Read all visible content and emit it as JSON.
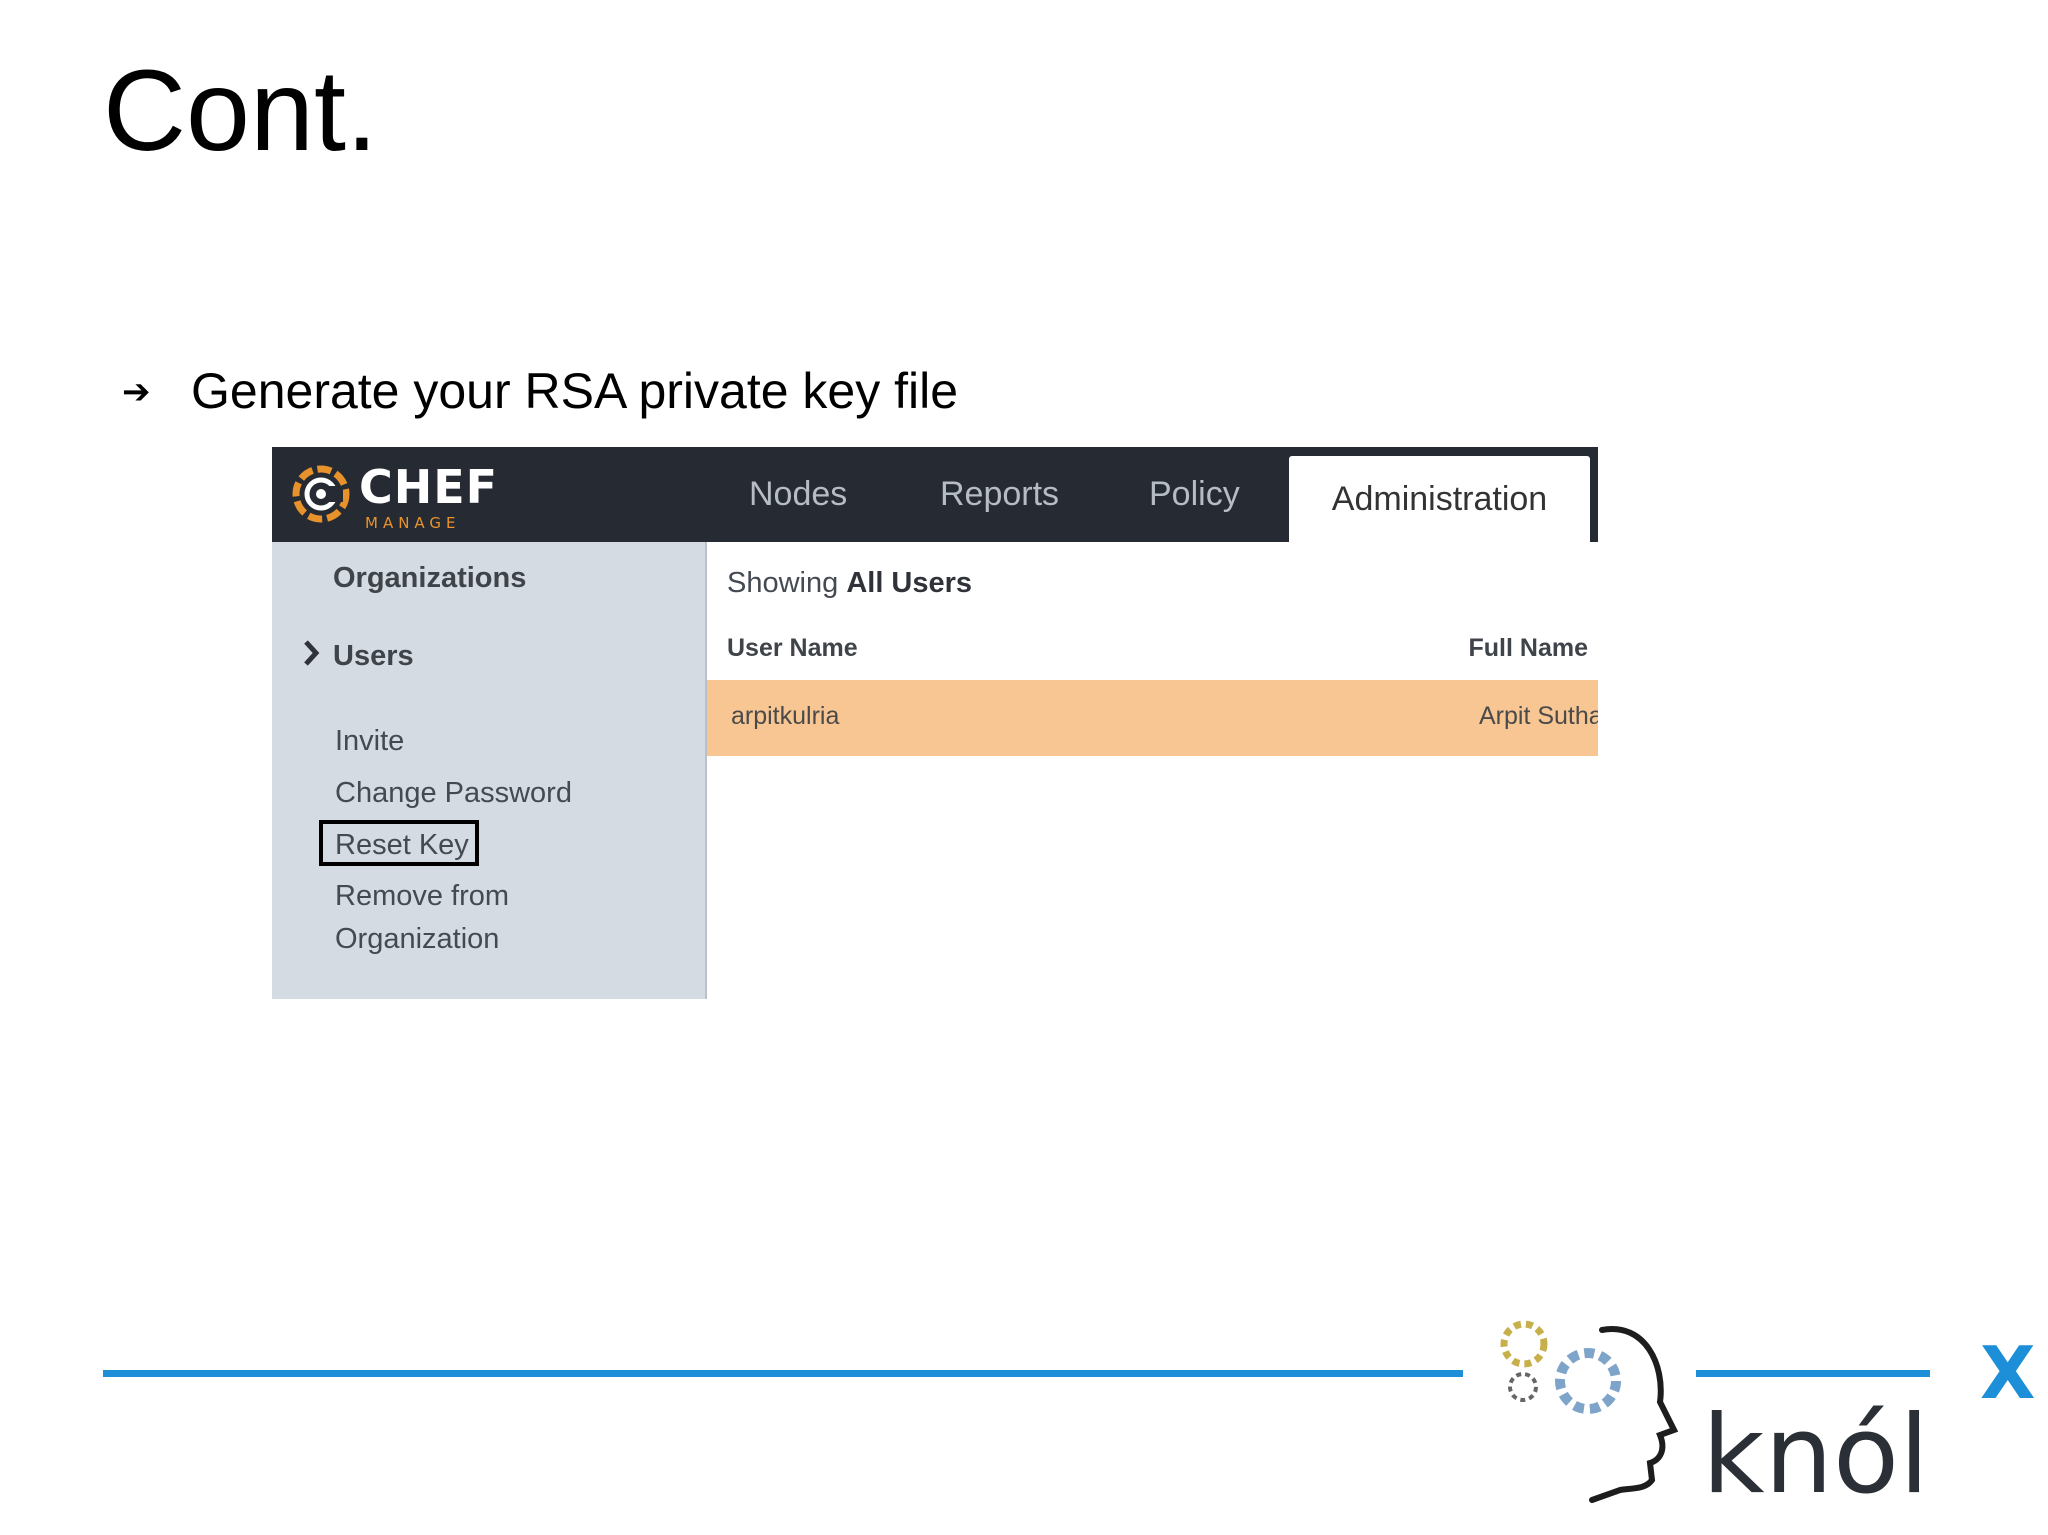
{
  "slide": {
    "title": "Cont.",
    "bullet": "Generate your RSA private key file"
  },
  "app": {
    "logo_text": "CHEF",
    "logo_subtext": "MANAGE",
    "tabs": [
      "Nodes",
      "Reports",
      "Policy",
      "Administration"
    ],
    "active_tab": "Administration",
    "sidebar": {
      "organizations": "Organizations",
      "users": "Users",
      "links": [
        "Invite",
        "Change Password",
        "Reset Key",
        "Remove from",
        "Organization"
      ],
      "highlighted": "Reset Key"
    },
    "main": {
      "heading_prefix": "Showing",
      "heading_bold": "All Users",
      "columns": [
        "User Name",
        "Full Name"
      ],
      "rows": [
        {
          "user_name": "arpitkulria",
          "full_name": "Arpit Suthar"
        }
      ]
    }
  },
  "footer": {
    "brand": "knól",
    "brand_sup": "X"
  },
  "colors": {
    "navbar": "#262b33",
    "sidebar": "#d5dbe2",
    "selected_row": "#f7c692",
    "rule": "#1d8fd8",
    "chef_orange": "#e8922b"
  }
}
